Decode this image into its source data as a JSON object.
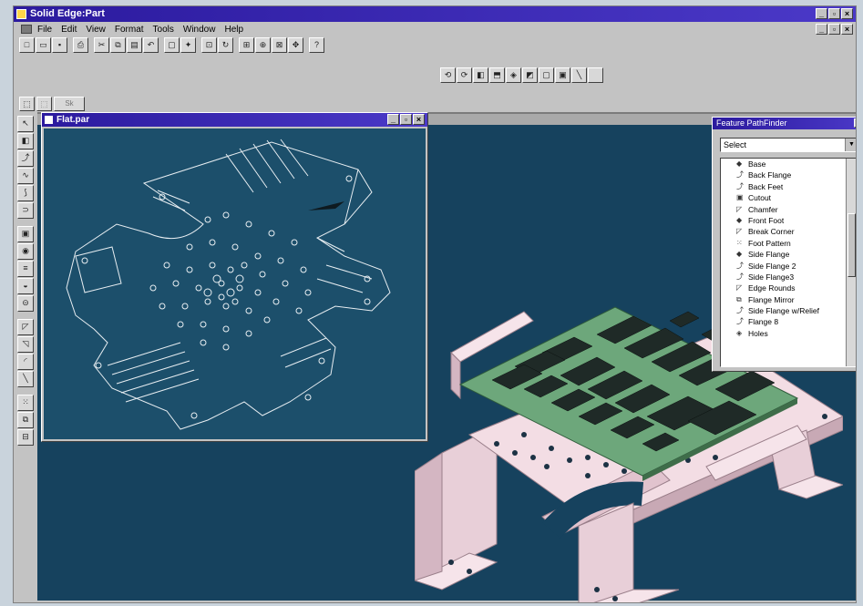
{
  "window": {
    "title": "Solid Edge:Part",
    "minimize": "_",
    "maximize": "▫",
    "close": "×"
  },
  "menu": [
    {
      "label": "File",
      "key": "F"
    },
    {
      "label": "Edit",
      "key": "E"
    },
    {
      "label": "View",
      "key": "V"
    },
    {
      "label": "Format",
      "key": "o"
    },
    {
      "label": "Tools",
      "key": "T"
    },
    {
      "label": "Window",
      "key": "W"
    },
    {
      "label": "Help",
      "key": "H"
    }
  ],
  "tabs": {
    "sketch_tab": "Sk"
  },
  "flat_window": {
    "title": "Flat.par"
  },
  "finder": {
    "title": "Feature PathFinder",
    "close": "×",
    "select_value": "Select",
    "items": [
      {
        "label": "Base",
        "icon": "base-icon",
        "glyph": "◆"
      },
      {
        "label": "Back Flange",
        "icon": "flange-icon",
        "glyph": "⤴"
      },
      {
        "label": "Back Feet",
        "icon": "flange-icon",
        "glyph": "⤴"
      },
      {
        "label": "Cutout",
        "icon": "cutout-icon",
        "glyph": "▣"
      },
      {
        "label": "Chamfer",
        "icon": "chamfer-icon",
        "glyph": "◸"
      },
      {
        "label": "Front Foot",
        "icon": "foot-icon",
        "glyph": "◆"
      },
      {
        "label": "Break Corner",
        "icon": "corner-icon",
        "glyph": "◸"
      },
      {
        "label": "Foot Pattern",
        "icon": "pattern-icon",
        "glyph": "⁙"
      },
      {
        "label": "Side Flange",
        "icon": "flange-icon",
        "glyph": "◆"
      },
      {
        "label": "Side Flange 2",
        "icon": "flange-icon",
        "glyph": "⤴"
      },
      {
        "label": "Side Flange3",
        "icon": "flange-icon",
        "glyph": "⤴"
      },
      {
        "label": "Edge Rounds",
        "icon": "round-icon",
        "glyph": "◸"
      },
      {
        "label": "Flange Mirror",
        "icon": "mirror-icon",
        "glyph": "⧉"
      },
      {
        "label": "Side Flange w/Relief",
        "icon": "flange-icon",
        "glyph": "⤴"
      },
      {
        "label": "Flange 8",
        "icon": "flange-icon",
        "glyph": "⤴"
      },
      {
        "label": "Holes",
        "icon": "hole-icon",
        "glyph": "◈"
      }
    ]
  },
  "colors": {
    "workspace": "#16425e",
    "titlebar": "#2b1a9e",
    "sheet_metal": "#f3dde4",
    "board": "#5e9e6e"
  }
}
